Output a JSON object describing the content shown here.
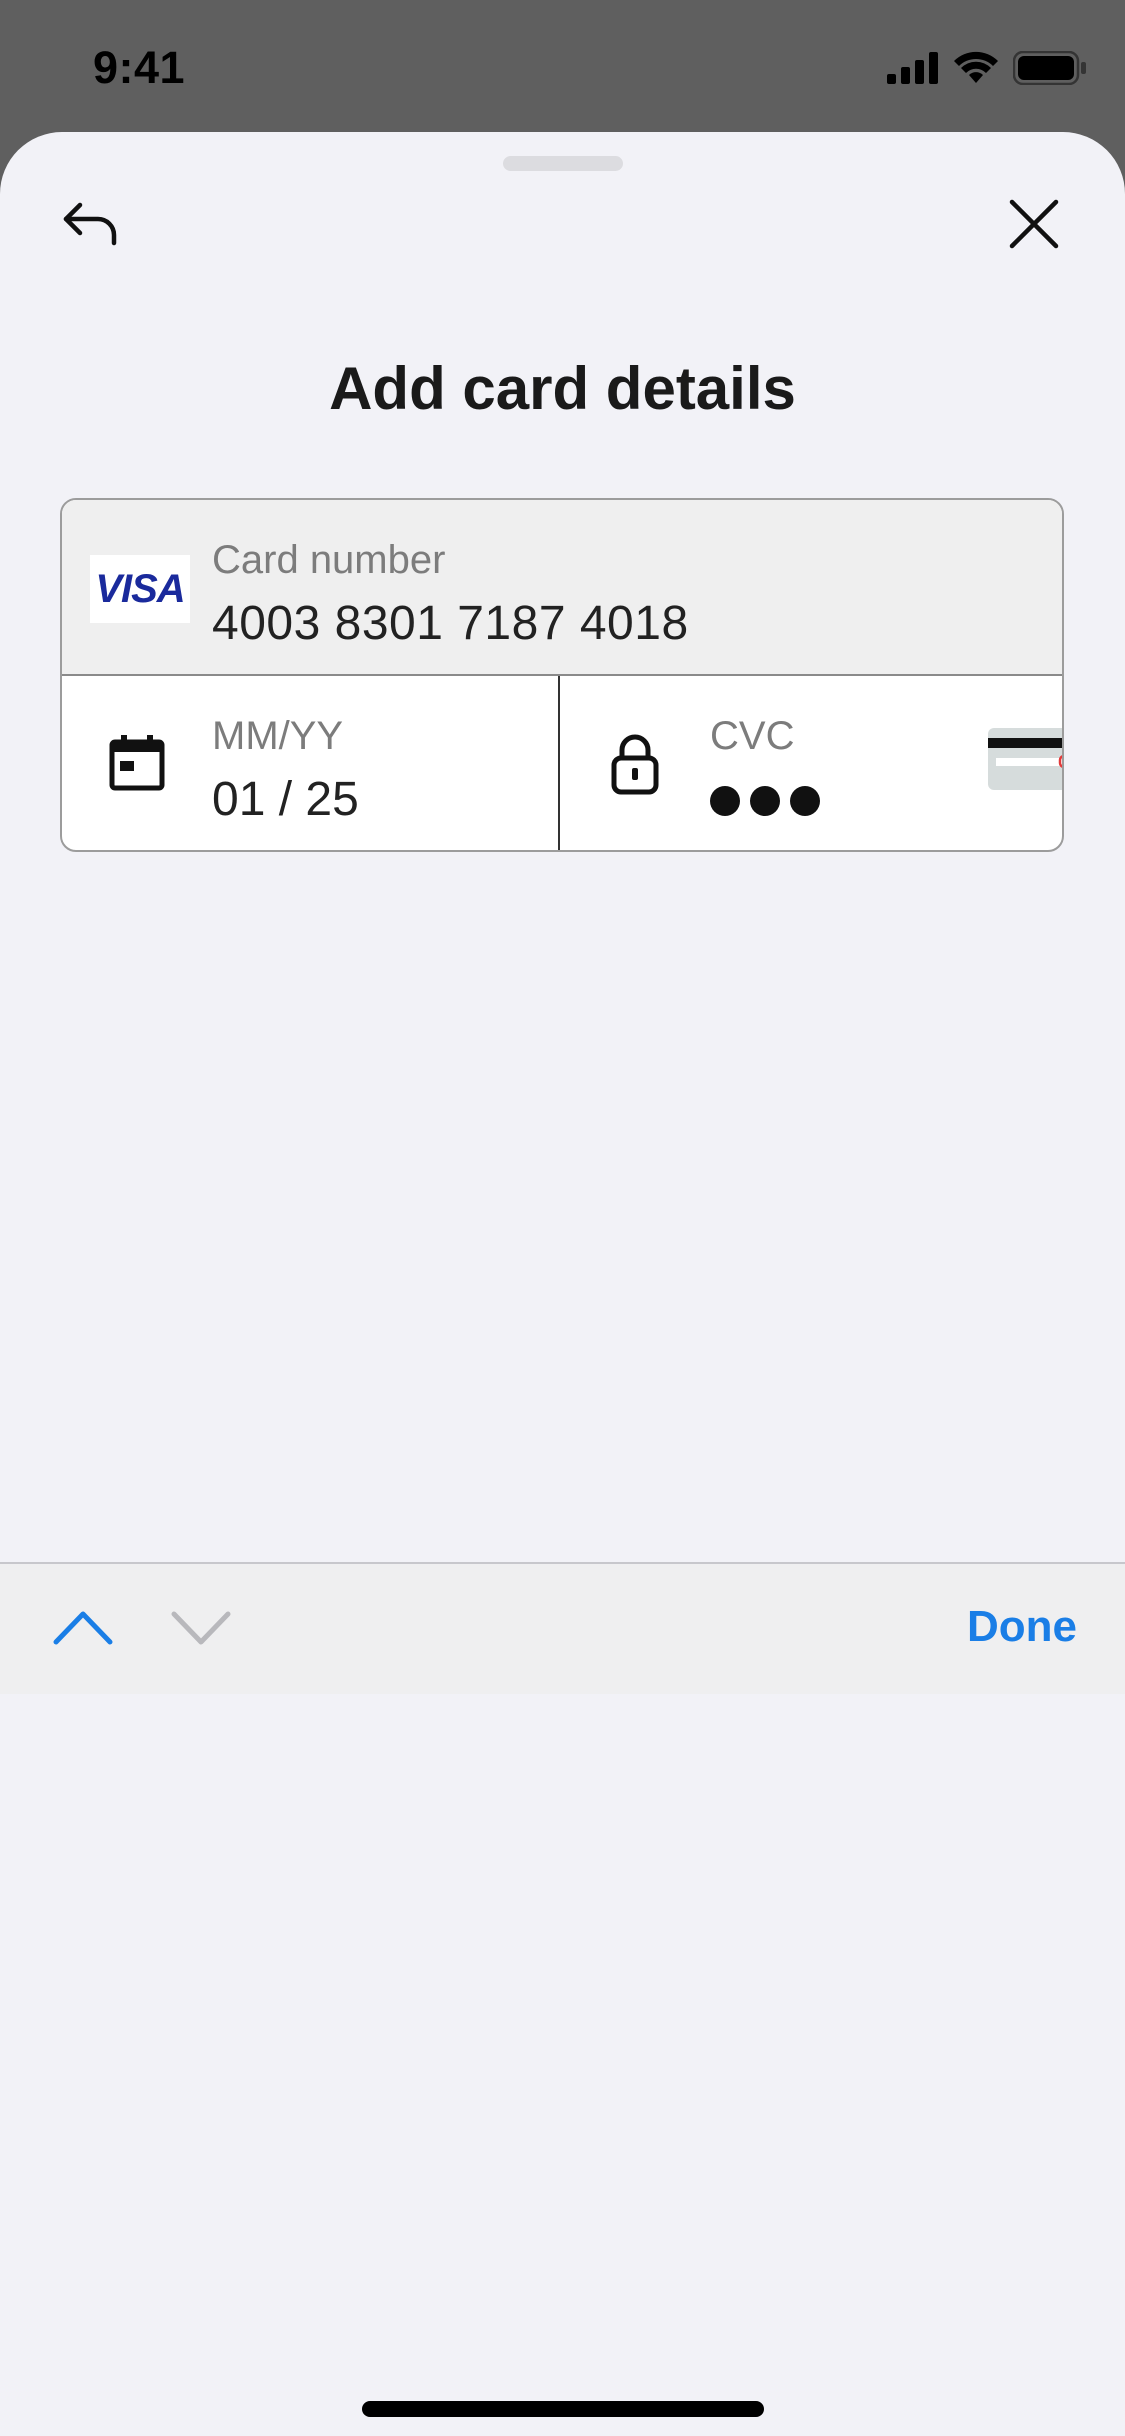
{
  "status_bar": {
    "time": "9:41"
  },
  "sheet": {
    "title": "Add card details"
  },
  "card_form": {
    "brand": "VISA",
    "card_number_label": "Card number",
    "card_number_value": "4003 8301 7187 4018",
    "expiry_label": "MM/YY",
    "expiry_value": "01 / 25",
    "cvc_label": "CVC"
  },
  "keyboard_toolbar": {
    "done_label": "Done"
  },
  "colors": {
    "accent": "#1a7ee6",
    "visa_blue": "#1a2a9c",
    "sheet_background": "#f2f2f7"
  },
  "icons": [
    "back-arrow-icon",
    "close-icon",
    "calendar-icon",
    "lock-icon",
    "card-back-icon",
    "chevron-up-icon",
    "chevron-down-icon"
  ]
}
